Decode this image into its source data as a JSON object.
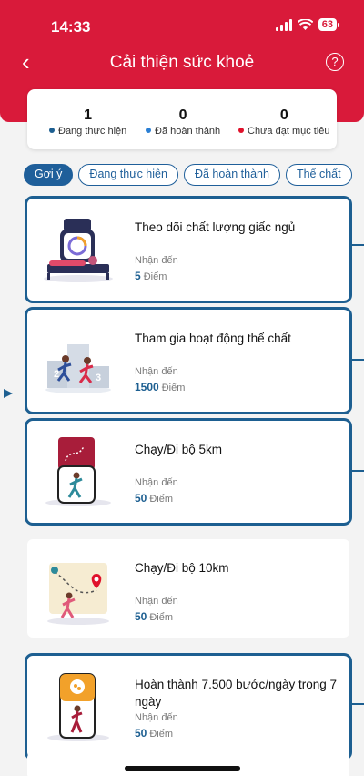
{
  "status": {
    "time": "14:33",
    "battery": "63"
  },
  "nav": {
    "title": "Cải thiện sức khoẻ",
    "help_symbol": "?",
    "back_symbol": "‹"
  },
  "stats": [
    {
      "value": "1",
      "label": "Đang thực hiện",
      "color": "#1d5f91"
    },
    {
      "value": "0",
      "label": "Đã hoàn thành",
      "color": "#2a7fd4"
    },
    {
      "value": "0",
      "label": "Chưa đạt mục tiêu",
      "color": "#e0112b"
    }
  ],
  "filters": [
    "Gợi ý",
    "Đang thực hiện",
    "Đã hoàn thành",
    "Thể chất"
  ],
  "cards": [
    {
      "title": "Theo dõi chất lượng giấc ngủ",
      "sub": "Nhận đến",
      "points": "5",
      "unit": "Điểm",
      "illustration": "sleep-tracker-watch-icon"
    },
    {
      "title": "Tham gia hoạt động thể chất",
      "sub": "Nhận đến",
      "points": "1500",
      "unit": "Điểm",
      "illustration": "podium-runners-icon"
    },
    {
      "title": "Chạy/Đi bộ 5km",
      "sub": "Nhận đến",
      "points": "50",
      "unit": "Điểm",
      "illustration": "phone-runner-icon"
    },
    {
      "title": "Chạy/Đi bộ 10km",
      "sub": "Nhận đến",
      "points": "50",
      "unit": "Điểm",
      "illustration": "map-route-runner-icon"
    },
    {
      "title": "Hoàn thành 7.500 bước/ngày trong 7 ngày",
      "sub": "Nhận đến",
      "points": "50",
      "unit": "Điểm",
      "illustration": "phone-steps-icon"
    }
  ],
  "colors": {
    "brand_red": "#d91a3a",
    "accent_blue": "#1d5f91"
  }
}
